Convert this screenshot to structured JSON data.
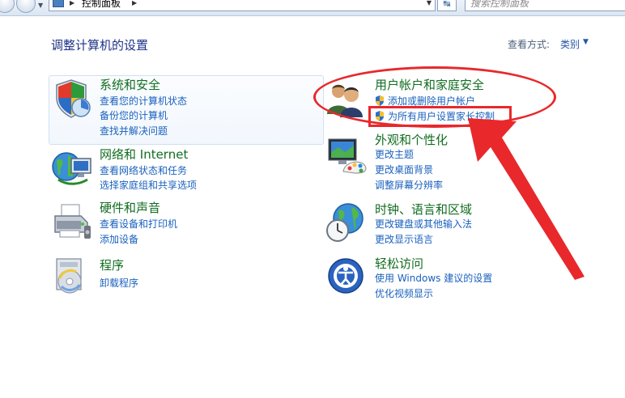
{
  "address_bar": {
    "breadcrumb": "控制面板",
    "search_placeholder": "搜索控制面板"
  },
  "page_title": "调整计算机的设置",
  "view_by": {
    "label": "查看方式:",
    "value": "类别"
  },
  "categories": [
    {
      "title": "系统和安全",
      "icon": "shield-icon",
      "links": [
        "查看您的计算机状态",
        "备份您的计算机",
        "查找并解决问题"
      ]
    },
    {
      "title": "网络和 Internet",
      "icon": "network-globe-icon",
      "links": [
        "查看网络状态和任务",
        "选择家庭组和共享选项"
      ]
    },
    {
      "title": "硬件和声音",
      "icon": "printer-icon",
      "links": [
        "查看设备和打印机",
        "添加设备"
      ]
    },
    {
      "title": "程序",
      "icon": "programs-disc-icon",
      "links": [
        "卸载程序"
      ]
    },
    {
      "title": "用户帐户和家庭安全",
      "icon": "users-icon",
      "links": [
        "添加或删除用户帐户",
        "为所有用户设置家长控制"
      ]
    },
    {
      "title": "外观和个性化",
      "icon": "monitor-palette-icon",
      "links": [
        "更改主题",
        "更改桌面背景",
        "调整屏幕分辨率"
      ]
    },
    {
      "title": "时钟、语言和区域",
      "icon": "clock-globe-icon",
      "links": [
        "更改键盘或其他输入法",
        "更改显示语言"
      ]
    },
    {
      "title": "轻松访问",
      "icon": "ease-of-access-icon",
      "links": [
        "使用 Windows 建议的设置",
        "优化视频显示"
      ]
    }
  ],
  "colors": {
    "category_title": "#116d20",
    "link": "#1a61bd",
    "annotation": "#e8282b"
  }
}
